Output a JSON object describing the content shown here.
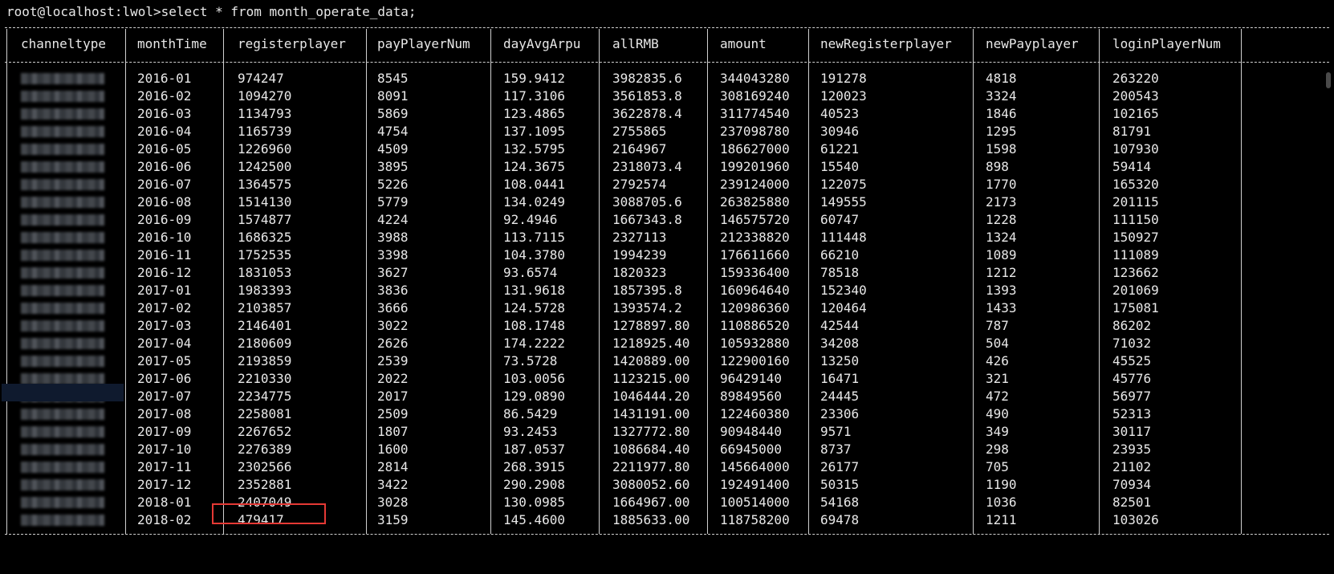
{
  "terminal": {
    "prompt": "root@localhost:lwol>select * from month_operate_data;",
    "border_text": "+",
    "pipe": "|"
  },
  "table": {
    "columns": [
      "channeltype",
      "monthTime",
      "registerplayer",
      "payPlayerNum",
      "dayAvgArpu",
      "allRMB",
      "amount",
      "newRegisterplayer",
      "newPayplayer",
      "loginPlayerNum"
    ],
    "rows": [
      {
        "monthTime": "2016-01",
        "registerplayer": "974247",
        "payPlayerNum": "8545",
        "dayAvgArpu": "159.9412",
        "allRMB": "3982835.6",
        "amount": "344043280",
        "newRegisterplayer": "191278",
        "newPayplayer": "4818",
        "loginPlayerNum": "263220"
      },
      {
        "monthTime": "2016-02",
        "registerplayer": "1094270",
        "payPlayerNum": "8091",
        "dayAvgArpu": "117.3106",
        "allRMB": "3561853.8",
        "amount": "308169240",
        "newRegisterplayer": "120023",
        "newPayplayer": "3324",
        "loginPlayerNum": "200543"
      },
      {
        "monthTime": "2016-03",
        "registerplayer": "1134793",
        "payPlayerNum": "5869",
        "dayAvgArpu": "123.4865",
        "allRMB": "3622878.4",
        "amount": "311774540",
        "newRegisterplayer": "40523",
        "newPayplayer": "1846",
        "loginPlayerNum": "102165"
      },
      {
        "monthTime": "2016-04",
        "registerplayer": "1165739",
        "payPlayerNum": "4754",
        "dayAvgArpu": "137.1095",
        "allRMB": "2755865",
        "amount": "237098780",
        "newRegisterplayer": "30946",
        "newPayplayer": "1295",
        "loginPlayerNum": "81791"
      },
      {
        "monthTime": "2016-05",
        "registerplayer": "1226960",
        "payPlayerNum": "4509",
        "dayAvgArpu": "132.5795",
        "allRMB": "2164967",
        "amount": "186627000",
        "newRegisterplayer": "61221",
        "newPayplayer": "1598",
        "loginPlayerNum": "107930"
      },
      {
        "monthTime": "2016-06",
        "registerplayer": "1242500",
        "payPlayerNum": "3895",
        "dayAvgArpu": "124.3675",
        "allRMB": "2318073.4",
        "amount": "199201960",
        "newRegisterplayer": "15540",
        "newPayplayer": "898",
        "loginPlayerNum": "59414"
      },
      {
        "monthTime": "2016-07",
        "registerplayer": "1364575",
        "payPlayerNum": "5226",
        "dayAvgArpu": "108.0441",
        "allRMB": "2792574",
        "amount": "239124000",
        "newRegisterplayer": "122075",
        "newPayplayer": "1770",
        "loginPlayerNum": "165320"
      },
      {
        "monthTime": "2016-08",
        "registerplayer": "1514130",
        "payPlayerNum": "5779",
        "dayAvgArpu": "134.0249",
        "allRMB": "3088705.6",
        "amount": "263825880",
        "newRegisterplayer": "149555",
        "newPayplayer": "2173",
        "loginPlayerNum": "201115"
      },
      {
        "monthTime": "2016-09",
        "registerplayer": "1574877",
        "payPlayerNum": "4224",
        "dayAvgArpu": "92.4946",
        "allRMB": "1667343.8",
        "amount": "146575720",
        "newRegisterplayer": "60747",
        "newPayplayer": "1228",
        "loginPlayerNum": "111150"
      },
      {
        "monthTime": "2016-10",
        "registerplayer": "1686325",
        "payPlayerNum": "3988",
        "dayAvgArpu": "113.7115",
        "allRMB": "2327113",
        "amount": "212338820",
        "newRegisterplayer": "111448",
        "newPayplayer": "1324",
        "loginPlayerNum": "150927"
      },
      {
        "monthTime": "2016-11",
        "registerplayer": "1752535",
        "payPlayerNum": "3398",
        "dayAvgArpu": "104.3780",
        "allRMB": "1994239",
        "amount": "176611660",
        "newRegisterplayer": "66210",
        "newPayplayer": "1089",
        "loginPlayerNum": "111089"
      },
      {
        "monthTime": "2016-12",
        "registerplayer": "1831053",
        "payPlayerNum": "3627",
        "dayAvgArpu": "93.6574",
        "allRMB": "1820323",
        "amount": "159336400",
        "newRegisterplayer": "78518",
        "newPayplayer": "1212",
        "loginPlayerNum": "123662"
      },
      {
        "monthTime": "2017-01",
        "registerplayer": "1983393",
        "payPlayerNum": "3836",
        "dayAvgArpu": "131.9618",
        "allRMB": "1857395.8",
        "amount": "160964640",
        "newRegisterplayer": "152340",
        "newPayplayer": "1393",
        "loginPlayerNum": "201069"
      },
      {
        "monthTime": "2017-02",
        "registerplayer": "2103857",
        "payPlayerNum": "3666",
        "dayAvgArpu": "124.5728",
        "allRMB": "1393574.2",
        "amount": "120986360",
        "newRegisterplayer": "120464",
        "newPayplayer": "1433",
        "loginPlayerNum": "175081"
      },
      {
        "monthTime": "2017-03",
        "registerplayer": "2146401",
        "payPlayerNum": "3022",
        "dayAvgArpu": "108.1748",
        "allRMB": "1278897.80",
        "amount": "110886520",
        "newRegisterplayer": "42544",
        "newPayplayer": "787",
        "loginPlayerNum": "86202"
      },
      {
        "monthTime": "2017-04",
        "registerplayer": "2180609",
        "payPlayerNum": "2626",
        "dayAvgArpu": "174.2222",
        "allRMB": "1218925.40",
        "amount": "105932880",
        "newRegisterplayer": "34208",
        "newPayplayer": "504",
        "loginPlayerNum": "71032"
      },
      {
        "monthTime": "2017-05",
        "registerplayer": "2193859",
        "payPlayerNum": "2539",
        "dayAvgArpu": "73.5728",
        "allRMB": "1420889.00",
        "amount": "122900160",
        "newRegisterplayer": "13250",
        "newPayplayer": "426",
        "loginPlayerNum": "45525"
      },
      {
        "monthTime": "2017-06",
        "registerplayer": "2210330",
        "payPlayerNum": "2022",
        "dayAvgArpu": "103.0056",
        "allRMB": "1123215.00",
        "amount": "96429140",
        "newRegisterplayer": "16471",
        "newPayplayer": "321",
        "loginPlayerNum": "45776"
      },
      {
        "monthTime": "2017-07",
        "registerplayer": "2234775",
        "payPlayerNum": "2017",
        "dayAvgArpu": "129.0890",
        "allRMB": "1046444.20",
        "amount": "89849560",
        "newRegisterplayer": "24445",
        "newPayplayer": "472",
        "loginPlayerNum": "56977"
      },
      {
        "monthTime": "2017-08",
        "registerplayer": "2258081",
        "payPlayerNum": "2509",
        "dayAvgArpu": "86.5429",
        "allRMB": "1431191.00",
        "amount": "122460380",
        "newRegisterplayer": "23306",
        "newPayplayer": "490",
        "loginPlayerNum": "52313"
      },
      {
        "monthTime": "2017-09",
        "registerplayer": "2267652",
        "payPlayerNum": "1807",
        "dayAvgArpu": "93.2453",
        "allRMB": "1327772.80",
        "amount": "90948440",
        "newRegisterplayer": "9571",
        "newPayplayer": "349",
        "loginPlayerNum": "30117"
      },
      {
        "monthTime": "2017-10",
        "registerplayer": "2276389",
        "payPlayerNum": "1600",
        "dayAvgArpu": "187.0537",
        "allRMB": "1086684.40",
        "amount": "66945000",
        "newRegisterplayer": "8737",
        "newPayplayer": "298",
        "loginPlayerNum": "23935"
      },
      {
        "monthTime": "2017-11",
        "registerplayer": "2302566",
        "payPlayerNum": "2814",
        "dayAvgArpu": "268.3915",
        "allRMB": "2211977.80",
        "amount": "145664000",
        "newRegisterplayer": "26177",
        "newPayplayer": "705",
        "loginPlayerNum": "21102"
      },
      {
        "monthTime": "2017-12",
        "registerplayer": "2352881",
        "payPlayerNum": "3422",
        "dayAvgArpu": "290.2908",
        "allRMB": "3080052.60",
        "amount": "192491400",
        "newRegisterplayer": "50315",
        "newPayplayer": "1190",
        "loginPlayerNum": "70934"
      },
      {
        "monthTime": "2018-01",
        "registerplayer": "2407049",
        "payPlayerNum": "3028",
        "dayAvgArpu": "130.0985",
        "allRMB": "1664967.00",
        "amount": "100514000",
        "newRegisterplayer": "54168",
        "newPayplayer": "1036",
        "loginPlayerNum": "82501"
      },
      {
        "monthTime": "2018-02",
        "registerplayer": "479417",
        "payPlayerNum": "3159",
        "dayAvgArpu": "145.4600",
        "allRMB": "1885633.00",
        "amount": "118758200",
        "newRegisterplayer": "69478",
        "newPayplayer": "1211",
        "loginPlayerNum": "103026"
      }
    ]
  },
  "colors": {
    "background": "#000000",
    "text": "#e8e8e8",
    "highlight": "#e53935"
  }
}
